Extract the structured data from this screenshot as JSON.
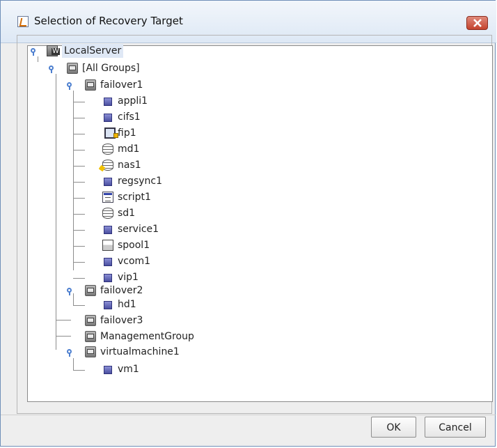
{
  "window": {
    "title": "Selection of Recovery Target",
    "close_label": "Close"
  },
  "tree": {
    "root": "LocalServer",
    "all_groups": "[All Groups]",
    "nodes": [
      {
        "label": "failover1",
        "type": "group",
        "expanded": true
      },
      {
        "label": "appli1",
        "type": "resource"
      },
      {
        "label": "cifs1",
        "type": "resource"
      },
      {
        "label": "fip1",
        "type": "fip"
      },
      {
        "label": "md1",
        "type": "disk"
      },
      {
        "label": "nas1",
        "type": "nas"
      },
      {
        "label": "regsync1",
        "type": "resource"
      },
      {
        "label": "script1",
        "type": "script"
      },
      {
        "label": "sd1",
        "type": "disk"
      },
      {
        "label": "service1",
        "type": "resource"
      },
      {
        "label": "spool1",
        "type": "spool"
      },
      {
        "label": "vcom1",
        "type": "resource"
      },
      {
        "label": "vip1",
        "type": "resource"
      },
      {
        "label": "failover2",
        "type": "group",
        "expanded": true
      },
      {
        "label": "hd1",
        "type": "resource"
      },
      {
        "label": "failover3",
        "type": "group"
      },
      {
        "label": "ManagementGroup",
        "type": "group"
      },
      {
        "label": "virtualmachine1",
        "type": "group",
        "expanded": true
      },
      {
        "label": "vm1",
        "type": "resource"
      }
    ]
  },
  "buttons": {
    "ok": "OK",
    "cancel": "Cancel"
  }
}
